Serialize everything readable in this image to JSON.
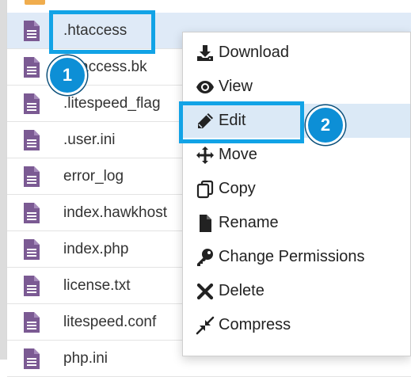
{
  "files": [
    {
      "name": ".htaccess"
    },
    {
      "name": ".htaccess.bk"
    },
    {
      "name": ".litespeed_flag"
    },
    {
      "name": ".user.ini"
    },
    {
      "name": "error_log"
    },
    {
      "name": "index.hawkhost"
    },
    {
      "name": "index.php"
    },
    {
      "name": "license.txt"
    },
    {
      "name": "litespeed.conf"
    },
    {
      "name": "php.ini"
    }
  ],
  "context_menu": {
    "items": [
      {
        "label": "Download",
        "icon": "download-icon"
      },
      {
        "label": "View",
        "icon": "eye-icon"
      },
      {
        "label": "Edit",
        "icon": "pencil-icon"
      },
      {
        "label": "Move",
        "icon": "move-arrows-icon"
      },
      {
        "label": "Copy",
        "icon": "copy-icon"
      },
      {
        "label": "Rename",
        "icon": "file-icon"
      },
      {
        "label": "Change Permissions",
        "icon": "key-icon"
      },
      {
        "label": "Delete",
        "icon": "x-icon"
      },
      {
        "label": "Compress",
        "icon": "compress-icon"
      }
    ]
  },
  "callouts": {
    "step1": "1",
    "step2": "2"
  },
  "colors": {
    "highlight": "#12a3e6",
    "selected_row": "#dfeaf7",
    "file_icon": "#7b5a93",
    "folder_icon": "#f0ad4e"
  }
}
